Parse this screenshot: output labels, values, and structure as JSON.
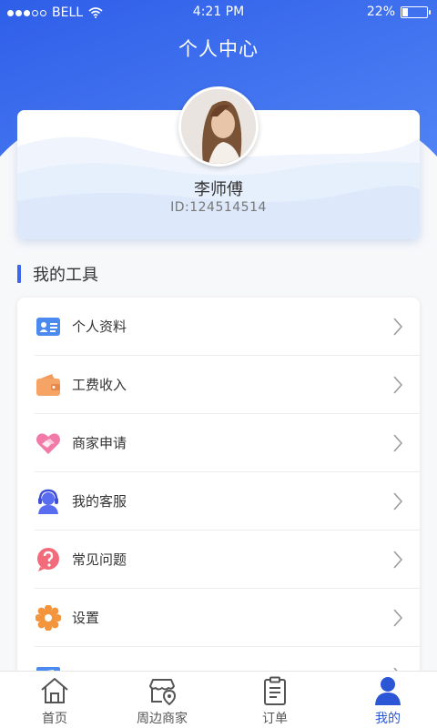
{
  "status_bar": {
    "carrier": "BELL",
    "time": "4:21 PM",
    "battery": "22%",
    "battery_level": 0.22
  },
  "header": {
    "title": "个人中心"
  },
  "profile": {
    "name": "李师傅",
    "id": "ID:124514514"
  },
  "tools": {
    "title": "我的工具",
    "items": [
      {
        "label": "个人资料",
        "icon": "id-card-icon"
      },
      {
        "label": "工费收入",
        "icon": "wallet-icon"
      },
      {
        "label": "商家申请",
        "icon": "handshake-heart-icon"
      },
      {
        "label": "我的客服",
        "icon": "customer-service-icon"
      },
      {
        "label": "常见问题",
        "icon": "question-icon"
      },
      {
        "label": "设置",
        "icon": "gear-icon"
      },
      {
        "label": "",
        "icon": "feedback-icon"
      }
    ]
  },
  "tabbar": {
    "tabs": [
      {
        "label": "首页",
        "icon": "home-icon"
      },
      {
        "label": "周边商家",
        "icon": "nearby-shop-icon"
      },
      {
        "label": "订单",
        "icon": "order-icon"
      },
      {
        "label": "我的",
        "icon": "user-icon",
        "active": true
      }
    ]
  },
  "colors": {
    "primary": "#3c66f0",
    "active_tab": "#2b57d6"
  }
}
